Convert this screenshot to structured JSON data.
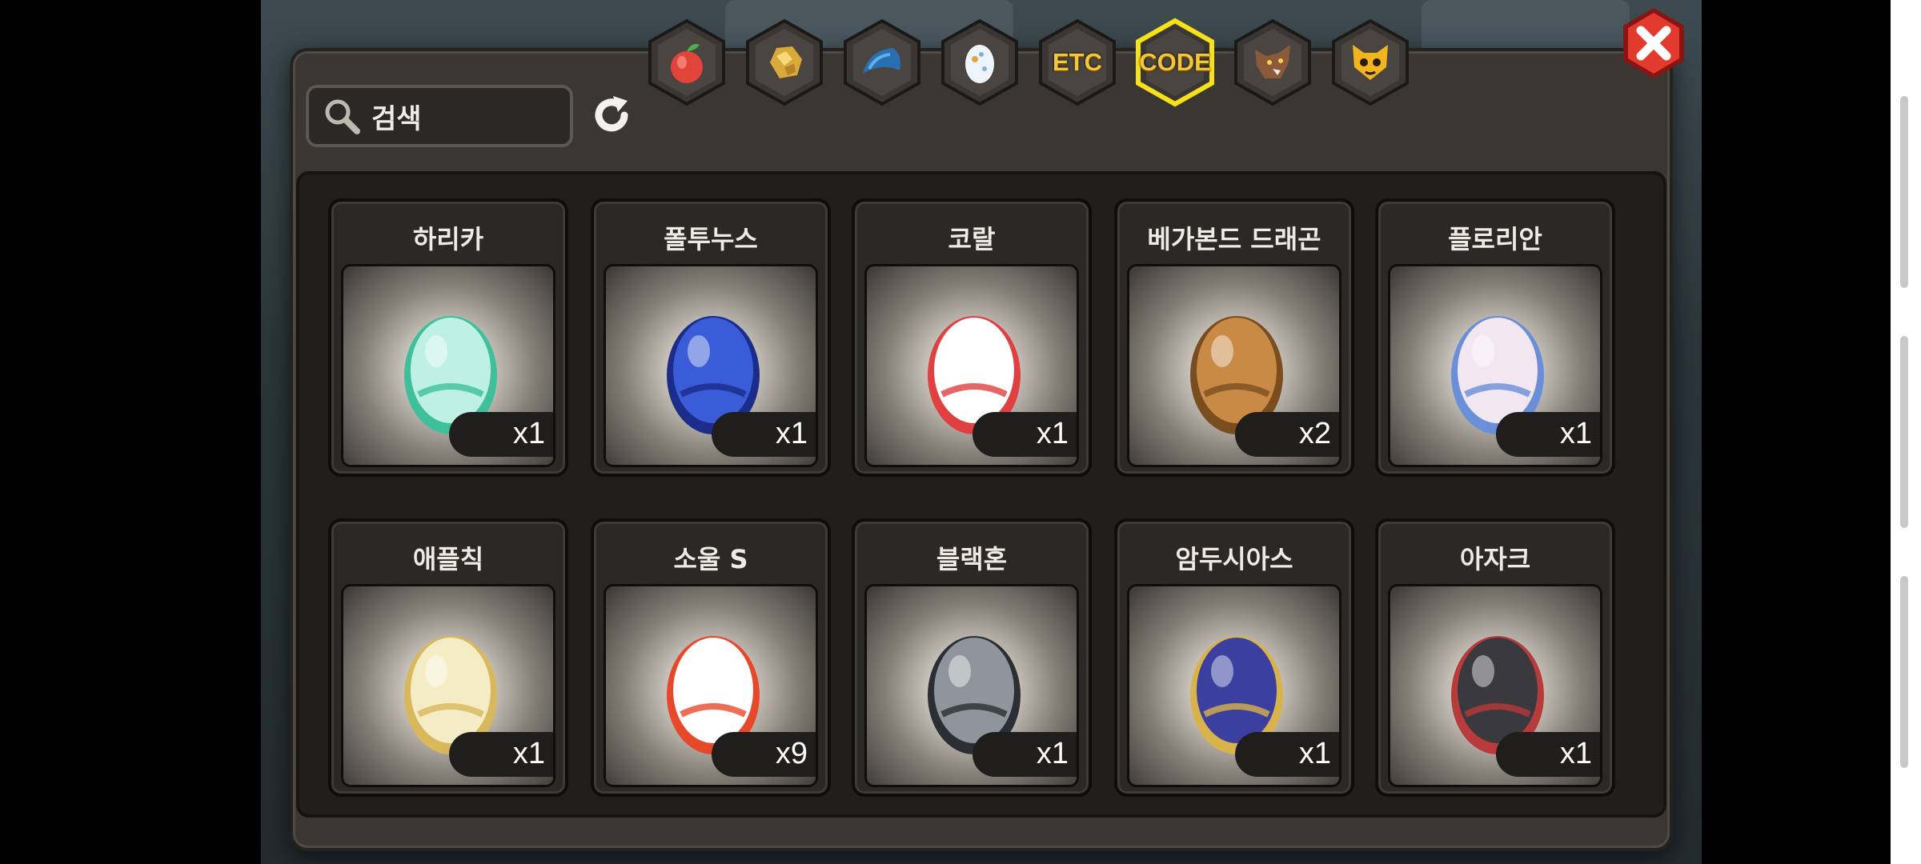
{
  "search": {
    "label": "검색"
  },
  "tabs": [
    {
      "id": "fruit",
      "icon": "fruit-icon",
      "label": "",
      "selected": false
    },
    {
      "id": "gold",
      "icon": "gold-nugget-icon",
      "label": "",
      "selected": false
    },
    {
      "id": "dragon",
      "icon": "dragon-scale-icon",
      "label": "",
      "selected": false
    },
    {
      "id": "egg",
      "icon": "egg-icon",
      "label": "",
      "selected": false
    },
    {
      "id": "etc",
      "icon": "",
      "label": "ETC",
      "selected": false
    },
    {
      "id": "code",
      "icon": "",
      "label": "CODE",
      "selected": true
    },
    {
      "id": "wolf",
      "icon": "wolf-head-icon",
      "label": "",
      "selected": false
    },
    {
      "id": "mask",
      "icon": "cat-mask-icon",
      "label": "",
      "selected": false
    }
  ],
  "items": [
    {
      "name": "하리카",
      "qty": "x1",
      "egg": "crown-egg-icon",
      "colors": [
        "#bff0e4",
        "#3fbf9a"
      ]
    },
    {
      "name": "폴투누스",
      "qty": "x1",
      "egg": "spiked-blue-egg-icon",
      "colors": [
        "#3a5cd8",
        "#1b2c8a"
      ]
    },
    {
      "name": "코랄",
      "qty": "x1",
      "egg": "horned-cloud-egg-icon",
      "colors": [
        "#ffffff",
        "#e04040"
      ]
    },
    {
      "name": "베가본드 드래곤",
      "qty": "x2",
      "egg": "cracked-brown-egg-icon",
      "colors": [
        "#c98a45",
        "#7a4d1f"
      ]
    },
    {
      "name": "플로리안",
      "qty": "x1",
      "egg": "winged-egg-icon",
      "colors": [
        "#f2e6f0",
        "#6a8fd8"
      ]
    },
    {
      "name": "애플칙",
      "qty": "x1",
      "egg": "leaf-egg-icon",
      "colors": [
        "#f4ecc4",
        "#d8b85a"
      ]
    },
    {
      "name": "소울 S",
      "qty": "x9",
      "egg": "flame-crystal-egg-icon",
      "colors": [
        "#ffffff",
        "#e8482a"
      ]
    },
    {
      "name": "블랙혼",
      "qty": "x1",
      "egg": "black-spiked-egg-icon",
      "colors": [
        "#8e959c",
        "#2b2f33"
      ]
    },
    {
      "name": "암두시아스",
      "qty": "x1",
      "egg": "laurel-emblem-egg-icon",
      "colors": [
        "#3a3fa0",
        "#d8b24a"
      ]
    },
    {
      "name": "아자크",
      "qty": "x1",
      "egg": "dark-horned-egg-icon",
      "colors": [
        "#3a3a3e",
        "#b83a3a"
      ]
    }
  ]
}
